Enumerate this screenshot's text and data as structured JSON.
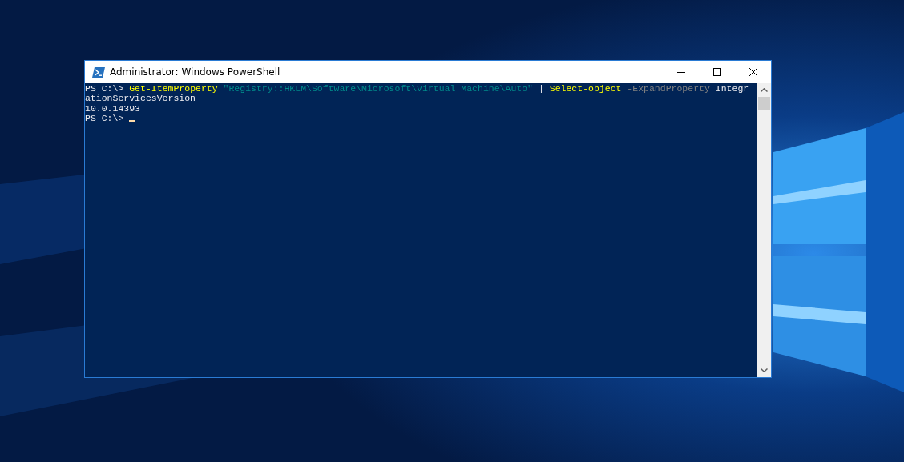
{
  "window": {
    "title": "Administrator: Windows PowerShell"
  },
  "console": {
    "lines": [
      [
        {
          "kind": "plain",
          "text": "PS C:\\> "
        },
        {
          "kind": "command",
          "text": "Get-ItemProperty"
        },
        {
          "kind": "string",
          "text": " \"Registry::HKLM\\Software\\Microsoft\\Virtual Machine\\Auto\""
        },
        {
          "kind": "plain",
          "text": " | "
        },
        {
          "kind": "command",
          "text": "Select-object"
        },
        {
          "kind": "parameter",
          "text": " -ExpandProperty"
        },
        {
          "kind": "plain",
          "text": " Integr"
        }
      ],
      [
        {
          "kind": "plain",
          "text": "ationServicesVersion"
        }
      ],
      [
        {
          "kind": "plain",
          "text": "10.0.14393"
        }
      ],
      [
        {
          "kind": "plain",
          "text": "PS C:\\> "
        }
      ]
    ],
    "cursor": true
  }
}
